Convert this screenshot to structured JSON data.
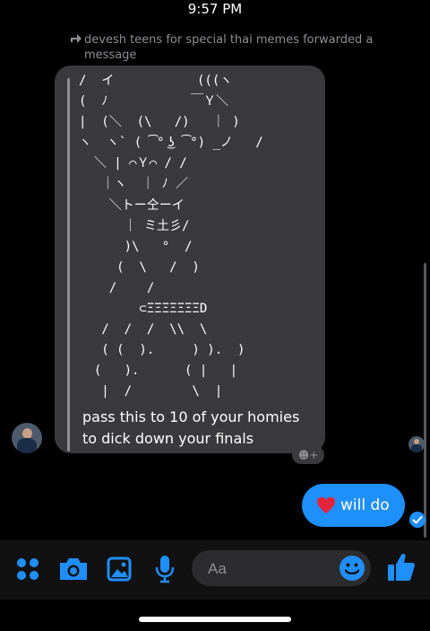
{
  "status_bar": {
    "time": "9:57 PM"
  },
  "forwarded": {
    "note": "devesh teens for special thai memes forwarded a message",
    "ascii_lines": [
      "/  イ           (((ヽ",
      "(  ﾉ           ￣Ｙ＼",
      "|  (＼  (\\   /)   ｜ )",
      "ヽ  ヽ` ( ͡° ͜ʖ ͡°) _ノ   /",
      "  ＼ | ⌒Ｙ⌒ / /",
      "   ｜ヽ  ｜ ﾉ ／",
      "    ＼トー仝ーイ",
      "      ｜ ミ土彡/",
      "      )\\   °  /",
      "     (  \\   /  )",
      "    /    /",
      "        ⊂ΞΞΞΞΞΞΞD",
      "   /  /  /  \\\\  \\",
      "   ( (  ).     ) ).  )",
      "  (   ).      ( |   |",
      "   |  /        \\  |"
    ],
    "text": "pass this to 10 of your homies to dick down your finals",
    "reaction_button": "☻+"
  },
  "my_message": {
    "text": "will do",
    "emoji": "heart"
  },
  "composer": {
    "placeholder": "Aa"
  },
  "colors": {
    "accent": "#1f8ffc",
    "bubble_gray": "#3a3a3c",
    "background": "#000000"
  }
}
